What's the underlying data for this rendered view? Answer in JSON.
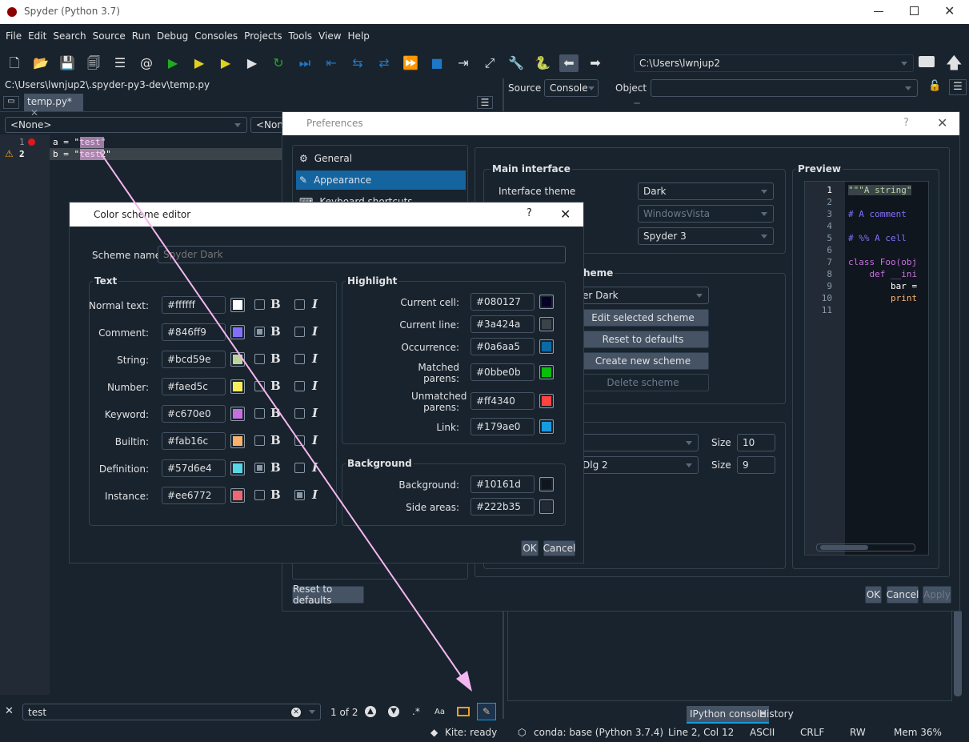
{
  "window": {
    "title": "Spyder (Python 3.7)"
  },
  "menu": [
    "File",
    "Edit",
    "Search",
    "Source",
    "Run",
    "Debug",
    "Consoles",
    "Projects",
    "Tools",
    "View",
    "Help"
  ],
  "toolbar": {
    "path": "C:\\Users\\lwnjup2"
  },
  "editor": {
    "file_path": "C:\\Users\\lwnjup2\\.spyder-py3-dev\\temp.py",
    "tab": "temp.py*",
    "class_combo": "<None>",
    "func_combo": "<None>",
    "lines": [
      {
        "num": "1",
        "code": "a = \"test\""
      },
      {
        "num": "2",
        "code": "b = \"test2\""
      }
    ]
  },
  "help_pane": {
    "source_label": "Source",
    "source_value": "Console",
    "object_label": "Object"
  },
  "findbar": {
    "query": "test",
    "count": "1 of 2",
    "case_label": "Aa"
  },
  "console_tabs": [
    "IPython console",
    "History"
  ],
  "status": {
    "kite": "Kite: ready",
    "conda": "conda: base (Python 3.7.4)",
    "position": "Line 2, Col 12",
    "encoding": "ASCII",
    "eol": "CRLF",
    "rw": "RW",
    "mem": "Mem 36%"
  },
  "prefs": {
    "title": "Preferences",
    "help": "?",
    "nav": [
      "General",
      "Appearance",
      "Keyboard shortcuts"
    ],
    "main_interface_title": "Main interface",
    "interface_theme_label": "Interface theme",
    "interface_theme": "Dark",
    "icon_theme": "WindowsVista",
    "syntax_theme": "Spyder 3",
    "scheme_title_fragment": "heme",
    "scheme_selected_fragment": "er Dark",
    "edit_scheme": "Edit selected scheme",
    "reset_scheme": "Reset to defaults",
    "create_scheme": "Create new scheme",
    "delete_scheme": "Delete scheme",
    "font_size_label": "Size",
    "font1_size": "10",
    "font2_fragment": "Dlg 2",
    "font2_size": "9",
    "preview_title": "Preview",
    "preview_lines": [
      {
        "num": "1",
        "text": "\"\"\"A string\""
      },
      {
        "num": "2",
        "text": ""
      },
      {
        "num": "3",
        "text": "# A comment"
      },
      {
        "num": "4",
        "text": ""
      },
      {
        "num": "5",
        "text": "# %% A cell"
      },
      {
        "num": "6",
        "text": ""
      },
      {
        "num": "7",
        "text": "class Foo(obj"
      },
      {
        "num": "8",
        "text": "    def __ini"
      },
      {
        "num": "9",
        "text": "        bar ="
      },
      {
        "num": "10",
        "text": "        print"
      },
      {
        "num": "11",
        "text": ""
      }
    ],
    "reset_defaults": "Reset to defaults",
    "ok": "OK",
    "cancel": "Cancel",
    "apply": "Apply"
  },
  "cse": {
    "title": "Color scheme editor",
    "help": "?",
    "scheme_name_label": "Scheme name:",
    "scheme_name_placeholder": "Spyder Dark",
    "text_title": "Text",
    "text_rows": [
      {
        "label": "Normal text:",
        "hex": "#ffffff",
        "color": "#ffffff",
        "bold": false,
        "italic": false
      },
      {
        "label": "Comment:",
        "hex": "#846ff9",
        "color": "#846ff9",
        "bold": true,
        "italic": false
      },
      {
        "label": "String:",
        "hex": "#bcd59e",
        "color": "#bcd59e",
        "bold": false,
        "italic": false
      },
      {
        "label": "Number:",
        "hex": "#faed5c",
        "color": "#faed5c",
        "bold": false,
        "italic": false
      },
      {
        "label": "Keyword:",
        "hex": "#c670e0",
        "color": "#c670e0",
        "bold": false,
        "italic": false
      },
      {
        "label": "Builtin:",
        "hex": "#fab16c",
        "color": "#fab16c",
        "bold": false,
        "italic": false
      },
      {
        "label": "Definition:",
        "hex": "#57d6e4",
        "color": "#57d6e4",
        "bold": true,
        "italic": false
      },
      {
        "label": "Instance:",
        "hex": "#ee6772",
        "color": "#ee6772",
        "bold": false,
        "italic": true
      }
    ],
    "highlight_title": "Highlight",
    "highlight_rows": [
      {
        "label": "Current cell:",
        "hex": "#080127",
        "color": "#080127"
      },
      {
        "label": "Current line:",
        "hex": "#3a424a",
        "color": "#3a424a"
      },
      {
        "label": "Occurrence:",
        "hex": "#0a6aa5",
        "color": "#0a6aa5"
      },
      {
        "label": "Matched parens:",
        "hex": "#0bbe0b",
        "color": "#0bbe0b"
      },
      {
        "label": "Unmatched parens:",
        "hex": "#ff4340",
        "color": "#ff4340"
      },
      {
        "label": "Link:",
        "hex": "#179ae0",
        "color": "#179ae0"
      }
    ],
    "background_title": "Background",
    "background_rows": [
      {
        "label": "Background:",
        "hex": "#10161d",
        "color": "#10161d"
      },
      {
        "label": "Side areas:",
        "hex": "#222b35",
        "color": "#222b35"
      }
    ],
    "ok": "OK",
    "cancel": "Cancel"
  }
}
